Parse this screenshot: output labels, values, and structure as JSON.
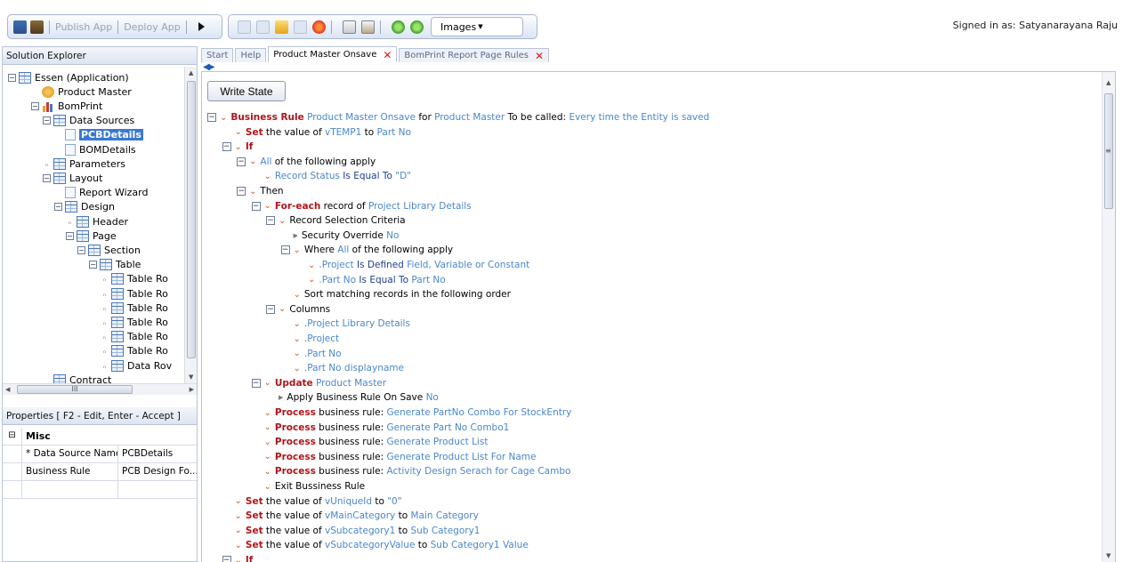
{
  "toolbar": {
    "publish_label": "Publish App",
    "deploy_label": "Deploy App",
    "images_label": "Images",
    "signed_in": "Signed in as: Satyanarayana Raju"
  },
  "solution_explorer": {
    "title": "Solution Explorer",
    "tree": [
      {
        "label": "Essen (Application)",
        "icon": "grid-icon",
        "toggle": "expanded"
      },
      {
        "label": "Product Master",
        "icon": "entity-icon",
        "toggle": "none"
      },
      {
        "label": "BomPrint",
        "icon": "report-chart-icon",
        "toggle": "expanded"
      },
      {
        "label": "Data Sources",
        "icon": "grid-icon",
        "toggle": "expanded"
      },
      {
        "label": "PCBDetails",
        "icon": "page-icon",
        "toggle": "none",
        "selected": true
      },
      {
        "label": "BOMDetails",
        "icon": "page-icon",
        "toggle": "none"
      },
      {
        "label": "Parameters",
        "icon": "grid-icon",
        "toggle": "collapsed"
      },
      {
        "label": "Layout",
        "icon": "grid-icon",
        "toggle": "expanded"
      },
      {
        "label": "Report Wizard",
        "icon": "page-icon",
        "toggle": "none"
      },
      {
        "label": "Design",
        "icon": "grid-icon",
        "toggle": "expanded"
      },
      {
        "label": "Header",
        "icon": "grid-icon",
        "toggle": "collapsed"
      },
      {
        "label": "Page",
        "icon": "grid-icon",
        "toggle": "expanded"
      },
      {
        "label": "Section",
        "icon": "grid-icon",
        "toggle": "expanded"
      },
      {
        "label": "Table",
        "icon": "grid-icon",
        "toggle": "expanded"
      },
      {
        "label": "Table Ro",
        "icon": "grid-icon",
        "toggle": "collapsed"
      },
      {
        "label": "Table Ro",
        "icon": "grid-icon",
        "toggle": "collapsed"
      },
      {
        "label": "Table Ro",
        "icon": "grid-icon",
        "toggle": "collapsed"
      },
      {
        "label": "Table Ro",
        "icon": "grid-icon",
        "toggle": "collapsed"
      },
      {
        "label": "Table Ro",
        "icon": "grid-icon",
        "toggle": "collapsed"
      },
      {
        "label": "Table Ro",
        "icon": "grid-icon",
        "toggle": "collapsed"
      },
      {
        "label": "Data Rov",
        "icon": "grid-icon",
        "toggle": "collapsed"
      },
      {
        "label": "Contract",
        "icon": "grid-icon",
        "toggle": "none"
      }
    ],
    "hscroll_thumb": "III"
  },
  "properties": {
    "title": "Properties [ F2 - Edit, Enter - Accept ]",
    "category": "Misc",
    "rows": [
      {
        "name": "* Data Source Name",
        "value": "PCBDetails"
      },
      {
        "name": "Business Rule",
        "value": "PCB Design Fo..."
      }
    ]
  },
  "tabs": [
    {
      "label": "Start",
      "active": false
    },
    {
      "label": "Help",
      "active": false
    },
    {
      "label": "Product Master Onsave",
      "active": true
    },
    {
      "label": "BomPrint Report Page Rules",
      "active": false
    }
  ],
  "editor": {
    "write_state_label": "Write State",
    "lines": [
      {
        "box": true,
        "arrow": "down",
        "segs": [
          {
            "t": "Business Rule",
            "c": "kw"
          },
          {
            "t": " Product Master Onsave",
            "c": "bl"
          },
          {
            "t": " for ",
            "c": "tx"
          },
          {
            "t": "Product Master",
            "c": "bl"
          },
          {
            "t": " To be called: ",
            "c": "tx"
          },
          {
            "t": "Every time the Entity is saved",
            "c": "bl"
          }
        ]
      },
      {
        "box": false,
        "arrow": "down",
        "segs": [
          {
            "t": "Set",
            "c": "kw"
          },
          {
            "t": " the value of ",
            "c": "tx"
          },
          {
            "t": "vTEMP1",
            "c": "bl"
          },
          {
            "t": " to ",
            "c": "tx"
          },
          {
            "t": "Part No",
            "c": "bl"
          }
        ]
      },
      {
        "box": true,
        "arrow": "down",
        "segs": [
          {
            "t": "If",
            "c": "kw"
          }
        ]
      },
      {
        "box": true,
        "arrow": "down",
        "segs": [
          {
            "t": "All",
            "c": "bl"
          },
          {
            "t": " of the following apply",
            "c": "tx"
          }
        ]
      },
      {
        "box": false,
        "arrow": "down",
        "segs": [
          {
            "t": "Record Status",
            "c": "bl"
          },
          {
            "t": " Is Equal To ",
            "c": "nv"
          },
          {
            "t": "\"D\"",
            "c": "bl"
          }
        ]
      },
      {
        "box": true,
        "arrow": "down",
        "segs": [
          {
            "t": "Then",
            "c": "tx"
          }
        ]
      },
      {
        "box": true,
        "arrow": "down",
        "segs": [
          {
            "t": "For-each",
            "c": "kw"
          },
          {
            "t": " record of ",
            "c": "tx"
          },
          {
            "t": "Project Library Details",
            "c": "bl"
          }
        ]
      },
      {
        "box": true,
        "arrow": "down",
        "segs": [
          {
            "t": "Record Selection Criteria",
            "c": "tx"
          }
        ]
      },
      {
        "box": false,
        "arrow": "right",
        "segs": [
          {
            "t": "Security Override ",
            "c": "tx"
          },
          {
            "t": "No",
            "c": "bl"
          }
        ]
      },
      {
        "box": true,
        "arrow": "down",
        "segs": [
          {
            "t": "Where ",
            "c": "tx"
          },
          {
            "t": "All",
            "c": "bl"
          },
          {
            "t": " of the following apply",
            "c": "tx"
          }
        ]
      },
      {
        "box": false,
        "arrow": "down",
        "segs": [
          {
            "t": ".Project",
            "c": "bl"
          },
          {
            "t": " Is Defined ",
            "c": "nv"
          },
          {
            "t": "Field, Variable or Constant",
            "c": "bl"
          }
        ]
      },
      {
        "box": false,
        "arrow": "down",
        "segs": [
          {
            "t": ".Part No",
            "c": "bl"
          },
          {
            "t": " Is Equal To ",
            "c": "nv"
          },
          {
            "t": "Part No",
            "c": "bl"
          }
        ]
      },
      {
        "box": false,
        "arrow": "down",
        "segs": [
          {
            "t": "Sort matching records in the following order",
            "c": "tx"
          }
        ]
      },
      {
        "box": true,
        "arrow": "down",
        "segs": [
          {
            "t": "Columns",
            "c": "tx"
          }
        ]
      },
      {
        "box": false,
        "arrow": "down",
        "segs": [
          {
            "t": ".Project Library Details",
            "c": "bl"
          }
        ]
      },
      {
        "box": false,
        "arrow": "down",
        "segs": [
          {
            "t": ".Project",
            "c": "bl"
          }
        ]
      },
      {
        "box": false,
        "arrow": "down",
        "segs": [
          {
            "t": ".Part No",
            "c": "bl"
          }
        ]
      },
      {
        "box": false,
        "arrow": "down",
        "segs": [
          {
            "t": ".Part No displayname",
            "c": "bl"
          }
        ]
      },
      {
        "box": true,
        "arrow": "down",
        "segs": [
          {
            "t": "Update",
            "c": "kw"
          },
          {
            "t": " Product Master",
            "c": "bl"
          }
        ]
      },
      {
        "box": false,
        "arrow": "right",
        "segs": [
          {
            "t": "Apply Business Rule On Save ",
            "c": "tx"
          },
          {
            "t": "No",
            "c": "bl"
          }
        ]
      },
      {
        "box": false,
        "arrow": "down",
        "segs": [
          {
            "t": "Process",
            "c": "kw"
          },
          {
            "t": " business rule: ",
            "c": "tx"
          },
          {
            "t": "Generate PartNo Combo For StockEntry",
            "c": "bl"
          }
        ]
      },
      {
        "box": false,
        "arrow": "down",
        "segs": [
          {
            "t": "Process",
            "c": "kw"
          },
          {
            "t": " business rule: ",
            "c": "tx"
          },
          {
            "t": "Generate Part No Combo1",
            "c": "bl"
          }
        ]
      },
      {
        "box": false,
        "arrow": "down",
        "segs": [
          {
            "t": "Process",
            "c": "kw"
          },
          {
            "t": " business rule: ",
            "c": "tx"
          },
          {
            "t": "Generate Product List",
            "c": "bl"
          }
        ]
      },
      {
        "box": false,
        "arrow": "down",
        "segs": [
          {
            "t": "Process",
            "c": "kw"
          },
          {
            "t": " business rule: ",
            "c": "tx"
          },
          {
            "t": "Generate Product List For Name",
            "c": "bl"
          }
        ]
      },
      {
        "box": false,
        "arrow": "down",
        "segs": [
          {
            "t": "Process",
            "c": "kw"
          },
          {
            "t": " business rule: ",
            "c": "tx"
          },
          {
            "t": "Activity Design Serach for Cage Cambo",
            "c": "bl"
          }
        ]
      },
      {
        "box": false,
        "arrow": "down",
        "segs": [
          {
            "t": "Exit Bussiness Rule",
            "c": "tx"
          }
        ]
      },
      {
        "box": false,
        "arrow": "down",
        "segs": [
          {
            "t": "Set",
            "c": "kw"
          },
          {
            "t": " the value of ",
            "c": "tx"
          },
          {
            "t": "vUniqueId",
            "c": "bl"
          },
          {
            "t": " to ",
            "c": "tx"
          },
          {
            "t": "\"0\"",
            "c": "bl"
          }
        ]
      },
      {
        "box": false,
        "arrow": "down",
        "segs": [
          {
            "t": "Set",
            "c": "kw"
          },
          {
            "t": " the value of ",
            "c": "tx"
          },
          {
            "t": "vMainCategory",
            "c": "bl"
          },
          {
            "t": " to ",
            "c": "tx"
          },
          {
            "t": "Main Category",
            "c": "bl"
          }
        ]
      },
      {
        "box": false,
        "arrow": "down",
        "segs": [
          {
            "t": "Set",
            "c": "kw"
          },
          {
            "t": " the value of ",
            "c": "tx"
          },
          {
            "t": "vSubcategory1",
            "c": "bl"
          },
          {
            "t": " to ",
            "c": "tx"
          },
          {
            "t": "Sub Category1",
            "c": "bl"
          }
        ]
      },
      {
        "box": false,
        "arrow": "down",
        "segs": [
          {
            "t": "Set",
            "c": "kw"
          },
          {
            "t": " the value of ",
            "c": "tx"
          },
          {
            "t": "vSubcategoryValue",
            "c": "bl"
          },
          {
            "t": " to ",
            "c": "tx"
          },
          {
            "t": "Sub Category1 Value",
            "c": "bl"
          }
        ]
      },
      {
        "box": true,
        "arrow": "down",
        "segs": [
          {
            "t": "If",
            "c": "kw"
          }
        ]
      }
    ]
  }
}
